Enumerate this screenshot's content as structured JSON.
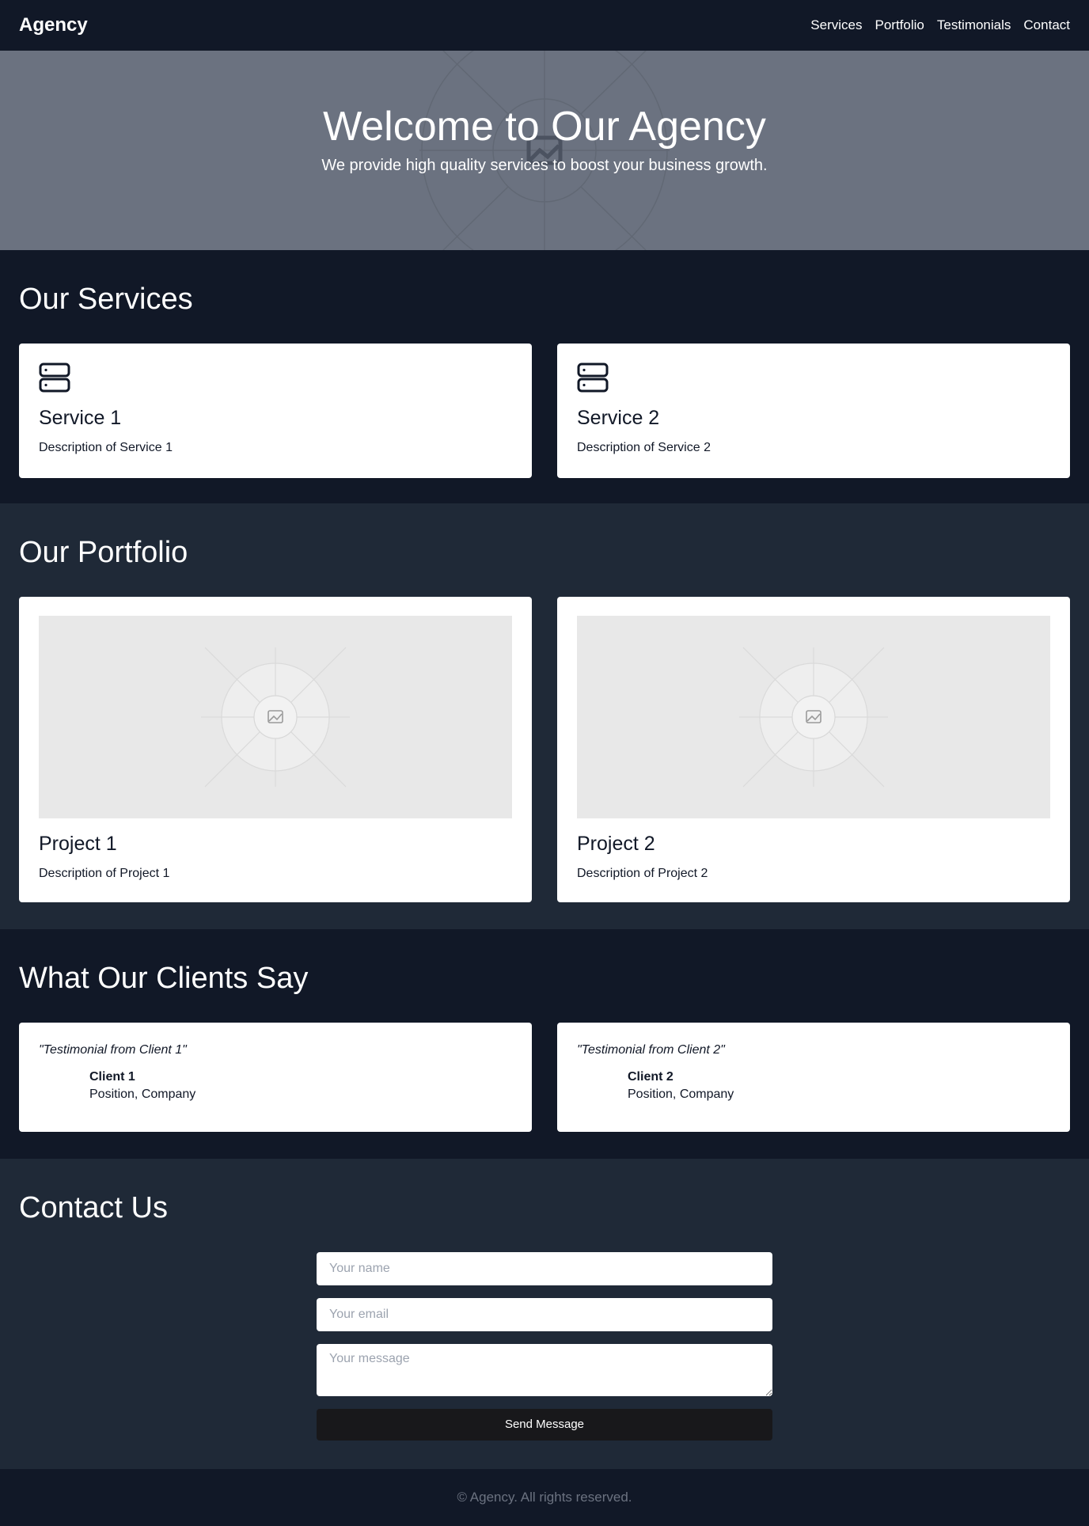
{
  "nav": {
    "brand": "Agency",
    "links": [
      "Services",
      "Portfolio",
      "Testimonials",
      "Contact"
    ]
  },
  "hero": {
    "title": "Welcome to Our Agency",
    "subtitle": "We provide high quality services to boost your business growth."
  },
  "services": {
    "heading": "Our Services",
    "items": [
      {
        "title": "Service 1",
        "description": "Description of Service 1",
        "icon": "server-icon"
      },
      {
        "title": "Service 2",
        "description": "Description of Service 2",
        "icon": "server-icon"
      }
    ]
  },
  "portfolio": {
    "heading": "Our Portfolio",
    "items": [
      {
        "title": "Project 1",
        "description": "Description of Project 1",
        "icon": "image-placeholder-icon"
      },
      {
        "title": "Project 2",
        "description": "Description of Project 2",
        "icon": "image-placeholder-icon"
      }
    ]
  },
  "testimonials": {
    "heading": "What Our Clients Say",
    "items": [
      {
        "quote": "\"Testimonial from Client 1\"",
        "name": "Client 1",
        "position": "Position, Company"
      },
      {
        "quote": "\"Testimonial from Client 2\"",
        "name": "Client 2",
        "position": "Position, Company"
      }
    ]
  },
  "contact": {
    "heading": "Contact Us",
    "name_placeholder": "Your name",
    "email_placeholder": "Your email",
    "message_placeholder": "Your message",
    "submit_label": "Send Message"
  },
  "footer": {
    "text": "© Agency. All rights reserved."
  },
  "colors": {
    "background": "#111827",
    "section_alt": "#1f2937",
    "hero": "#6b7280",
    "button": "#18181b"
  }
}
